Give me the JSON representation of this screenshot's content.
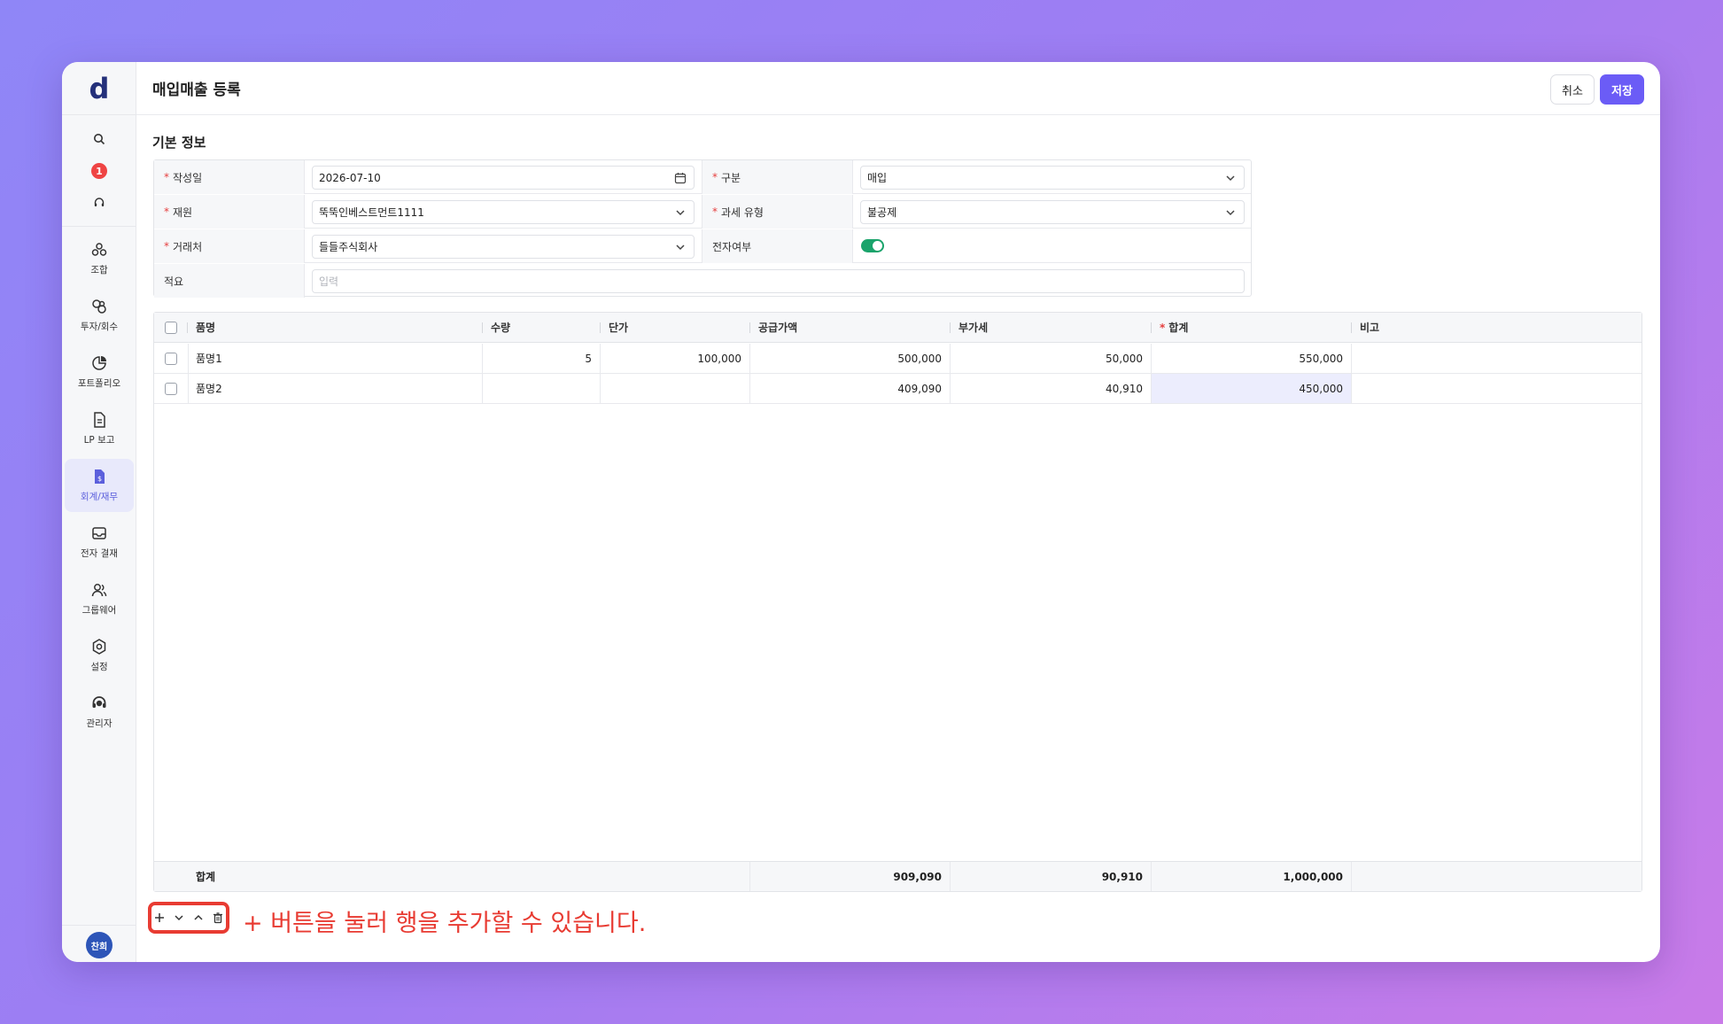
{
  "app": {
    "logo": "d"
  },
  "sidebar": {
    "notification_count": "1",
    "items": [
      {
        "label": "조합",
        "icon": "union-icon",
        "active": false
      },
      {
        "label": "투자/회수",
        "icon": "investment-icon",
        "active": false
      },
      {
        "label": "포트폴리오",
        "icon": "portfolio-icon",
        "active": false
      },
      {
        "label": "LP 보고",
        "icon": "report-icon",
        "active": false
      },
      {
        "label": "회계/재무",
        "icon": "accounting-icon",
        "active": true
      },
      {
        "label": "전자 결재",
        "icon": "approval-icon",
        "active": false
      },
      {
        "label": "그룹웨어",
        "icon": "groupware-icon",
        "active": false
      },
      {
        "label": "설정",
        "icon": "settings-icon",
        "active": false
      },
      {
        "label": "관리자",
        "icon": "admin-icon",
        "active": false
      }
    ],
    "user_initials": "찬희"
  },
  "header": {
    "title": "매입매출 등록",
    "cancel_label": "취소",
    "save_label": "저장"
  },
  "basic_info": {
    "section_title": "기본 정보",
    "date_label": "작성일",
    "date_value": "2026-07-10",
    "type_label": "구분",
    "type_value": "매입",
    "fund_label": "재원",
    "fund_value": "뚝뚝인베스트먼트1111",
    "tax_label": "과세 유형",
    "tax_value": "불공제",
    "partner_label": "거래처",
    "partner_value": "들들주식회사",
    "electronic_label": "전자여부",
    "electronic_on": true,
    "memo_label": "적요",
    "memo_placeholder": "입력"
  },
  "grid": {
    "columns": [
      "품명",
      "수량",
      "단가",
      "공급가액",
      "부가세",
      "합계",
      "비고"
    ],
    "rows": [
      {
        "name": "품명1",
        "qty": "5",
        "unit_price": "100,000",
        "supply": "500,000",
        "vat": "50,000",
        "total": "550,000",
        "note": ""
      },
      {
        "name": "품명2",
        "qty": "",
        "unit_price": "",
        "supply": "409,090",
        "vat": "40,910",
        "total": "450,000",
        "note": ""
      }
    ],
    "footer": {
      "label": "합계",
      "supply": "909,090",
      "vat": "90,910",
      "total": "1,000,000"
    }
  },
  "annotation": "+ 버튼을 눌러 행을 추가할 수 있습니다."
}
